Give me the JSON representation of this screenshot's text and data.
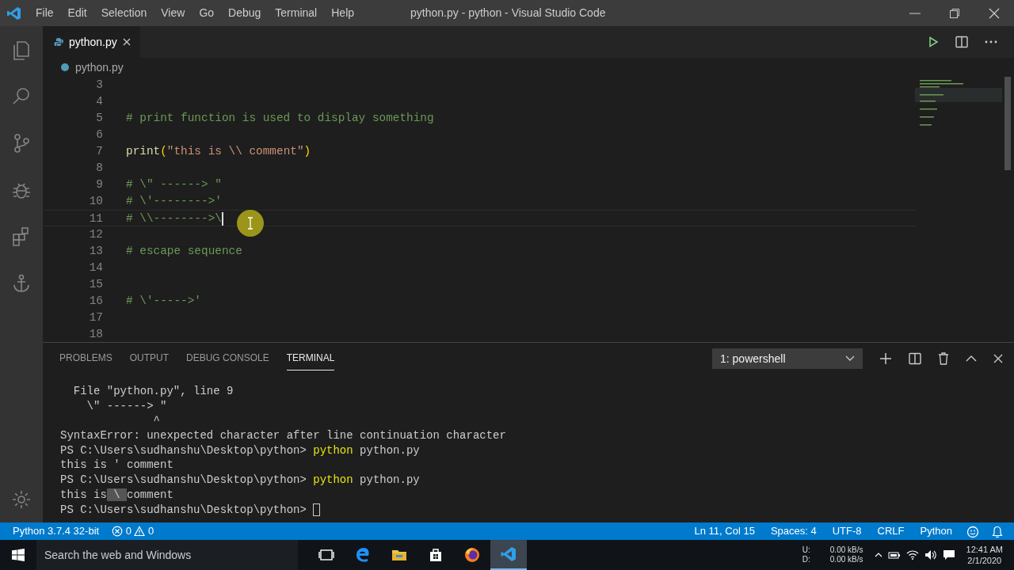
{
  "window": {
    "title": "python.py - python - Visual Studio Code"
  },
  "menu": [
    "File",
    "Edit",
    "Selection",
    "View",
    "Go",
    "Debug",
    "Terminal",
    "Help"
  ],
  "tabs": [
    {
      "label": "python.py",
      "selected": true
    }
  ],
  "breadcrumb": "python.py",
  "editor": {
    "lines": [
      {
        "number": "3"
      },
      {
        "number": "4"
      },
      {
        "number": "5",
        "tokens": [
          {
            "kind": "comment",
            "text": "# print function is used to display something"
          }
        ]
      },
      {
        "number": "6"
      },
      {
        "number": "7",
        "tokens": [
          {
            "kind": "function",
            "text": "print"
          },
          {
            "kind": "paren",
            "text": "("
          },
          {
            "kind": "string",
            "text": "\"this is \\\\ comment\""
          },
          {
            "kind": "paren",
            "text": ")"
          }
        ]
      },
      {
        "number": "8"
      },
      {
        "number": "9",
        "tokens": [
          {
            "kind": "comment",
            "text": "# \\\" ------> \""
          }
        ]
      },
      {
        "number": "10",
        "tokens": [
          {
            "kind": "comment",
            "text": "# \\'-------->'"
          }
        ]
      },
      {
        "number": "11",
        "current": true,
        "tokens": [
          {
            "kind": "comment",
            "text": "# \\\\-------->\\"
          }
        ]
      },
      {
        "number": "12"
      },
      {
        "number": "13",
        "tokens": [
          {
            "kind": "comment",
            "text": "# escape sequence"
          }
        ]
      },
      {
        "number": "14"
      },
      {
        "number": "15"
      },
      {
        "number": "16",
        "tokens": [
          {
            "kind": "comment",
            "text": "# \\'----->'"
          }
        ]
      },
      {
        "number": "17"
      },
      {
        "number": "18"
      }
    ]
  },
  "panel": {
    "tabs": [
      {
        "label": "PROBLEMS",
        "selected": false
      },
      {
        "label": "OUTPUT",
        "selected": false
      },
      {
        "label": "DEBUG CONSOLE",
        "selected": false
      },
      {
        "label": "TERMINAL",
        "selected": true
      }
    ],
    "terminal_select": "1: powershell",
    "lines": [
      [
        {
          "kind": "plain",
          "text": "  File \"python.py\", line 9"
        }
      ],
      [
        {
          "kind": "plain",
          "text": "    \\\" ------> \""
        }
      ],
      [
        {
          "kind": "plain",
          "text": "              ^"
        }
      ],
      [
        {
          "kind": "plain",
          "text": "SyntaxError: unexpected character after line continuation character"
        }
      ],
      [
        {
          "kind": "plain",
          "text": "PS C:\\Users\\sudhanshu\\Desktop\\python> "
        },
        {
          "kind": "command",
          "text": "python"
        },
        {
          "kind": "plain",
          "text": " python.py"
        }
      ],
      [
        {
          "kind": "plain",
          "text": "this is ' comment"
        }
      ],
      [
        {
          "kind": "plain",
          "text": "PS C:\\Users\\sudhanshu\\Desktop\\python> "
        },
        {
          "kind": "command",
          "text": "python"
        },
        {
          "kind": "plain",
          "text": " python.py"
        }
      ],
      [
        {
          "kind": "plain",
          "text": "this is"
        },
        {
          "kind": "selection",
          "text": " \\ "
        },
        {
          "kind": "plain",
          "text": "comment"
        }
      ],
      [
        {
          "kind": "plain",
          "text": "PS C:\\Users\\sudhanshu\\Desktop\\python> "
        },
        {
          "kind": "cursor"
        }
      ]
    ]
  },
  "status_bar": {
    "interpreter": "Python 3.7.4 32-bit",
    "errors": "0",
    "warnings": "0",
    "right": [
      "Ln 11, Col 15",
      "Spaces: 4",
      "UTF-8",
      "CRLF",
      "Python"
    ]
  },
  "taskbar": {
    "search": {
      "placeholder": "Search the web and Windows"
    },
    "network": [
      {
        "label": "U:",
        "rate": "0.00 kB/s"
      },
      {
        "label": "D:",
        "rate": "0.00 kB/s"
      }
    ],
    "time": "12:41 AM",
    "date": "2/1/2020"
  }
}
